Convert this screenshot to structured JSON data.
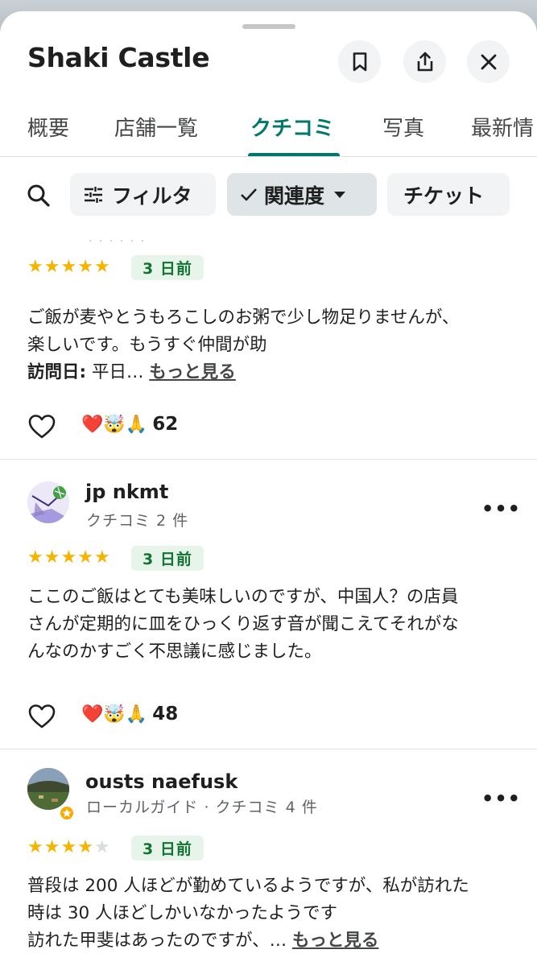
{
  "place": {
    "title": "Shaki Castle"
  },
  "header": {
    "save_icon": "bookmark-icon",
    "share_icon": "share-icon",
    "close_icon": "close-icon"
  },
  "tabs": [
    {
      "label": "概要"
    },
    {
      "label": "店舗一覧"
    },
    {
      "label": "クチコミ",
      "active": true
    },
    {
      "label": "写真"
    },
    {
      "label": "最新情"
    }
  ],
  "filters": {
    "search_icon": "search-icon",
    "filter_label": "フィルタ",
    "sort_label": "関連度",
    "ticket_label": "チケット"
  },
  "reviews": [
    {
      "rating": 5,
      "date": "3 日前",
      "text_line1": "ご飯が麦やとうもろこしのお粥で少し物足りませんが、",
      "text_line2": "楽しいです。もうすぐ仲間が助",
      "visit_label": "訪問日:",
      "visit_value": " 平日… ",
      "more": "もっと見る",
      "reactions": "❤️🤯🙏",
      "count": "62"
    },
    {
      "author": "jp nkmt",
      "meta": "クチコミ 2 件",
      "rating": 5,
      "date": "3 日前",
      "text_line1": "ここのご飯はとても美味しいのですが、中国人？の店員",
      "text_line2": "さんが定期的に皿をひっくり返す音が聞こえてそれがな",
      "text_line3": "んなのかすごく不思議に感じました。",
      "reactions": "❤️🤯🙏",
      "count": "48"
    },
    {
      "author": "ousts naefusk",
      "meta": "ローカルガイド · クチコミ 4 件",
      "rating": 4,
      "date": "3 日前",
      "text_line1": "普段は 200 人ほどが勤めているようですが、私が訪れた",
      "text_line2": "時は 30 人ほどしかいなかったようです",
      "text_line3": "訪れた甲斐はあったのですが、… ",
      "more": "もっと見る"
    }
  ],
  "colors": {
    "accent": "#00796b",
    "star": "#f5b400",
    "badge_bg": "#e6f4ea",
    "badge_text": "#137333"
  }
}
